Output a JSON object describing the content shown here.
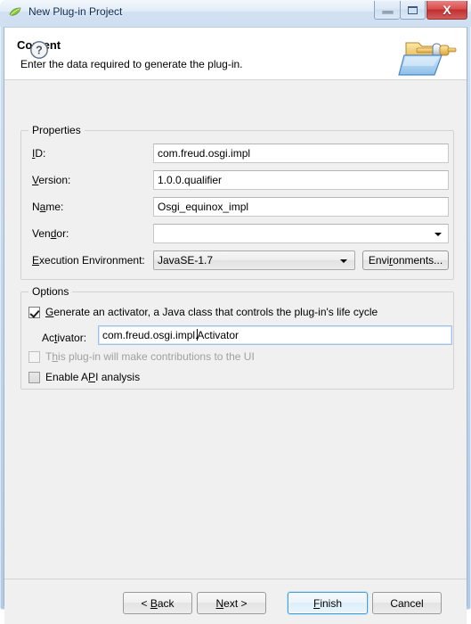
{
  "window": {
    "title": "New Plug-in Project",
    "icon": "eclipse-leaf-icon",
    "buttons": {
      "minimize": "minimize-icon",
      "maximize": "maximize-icon",
      "close": "X"
    }
  },
  "header": {
    "title": "Content",
    "description": "Enter the data required to generate the plug-in.",
    "icon": "plugin-wizard-icon"
  },
  "properties": {
    "group_label": "Properties",
    "fields": [
      {
        "label_pre": "",
        "label_mn": "I",
        "label_post": "D:",
        "value": "com.freud.osgi.impl",
        "type": "text"
      },
      {
        "label_pre": "",
        "label_mn": "V",
        "label_post": "ersion:",
        "value": "1.0.0.qualifier",
        "type": "text"
      },
      {
        "label_pre": "N",
        "label_mn": "a",
        "label_post": "me:",
        "value": "Osgi_equinox_impl",
        "type": "text"
      },
      {
        "label_pre": "Ven",
        "label_mn": "d",
        "label_post": "or:",
        "value": "",
        "type": "combo-edit"
      }
    ],
    "execution_environment": {
      "label_pre": "",
      "label_mn": "E",
      "label_post": "xecution Environment:",
      "value": "JavaSE-1.7",
      "button": {
        "pre": "Envi",
        "mn": "r",
        "post": "onments..."
      }
    }
  },
  "options": {
    "group_label": "Options",
    "generate_activator": {
      "label_pre": "",
      "label_mn": "G",
      "label_post": "enerate an activator, a Java class that controls the plug-in's life cycle",
      "checked": true
    },
    "activator": {
      "label_pre": "Ac",
      "label_mn": "t",
      "label_post": "ivator:",
      "value_before_caret": "com.freud.osgi.impl.",
      "value_after_caret": "Activator"
    },
    "ui_contributions": {
      "label_pre": "T",
      "label_mn": "h",
      "label_post": "is plug-in will make contributions to the UI",
      "checked": false,
      "disabled": true
    },
    "api_analysis": {
      "label_pre": "Enable A",
      "label_mn": "P",
      "label_post": "I analysis",
      "checked": false,
      "disabled": false
    }
  },
  "buttonbar": {
    "help": "help-icon",
    "back": {
      "pre": "< ",
      "mn": "B",
      "post": "ack"
    },
    "next": {
      "pre": "",
      "mn": "N",
      "post": "ext >"
    },
    "finish": {
      "pre": "",
      "mn": "F",
      "post": "inish"
    },
    "cancel": {
      "pre": "Cancel",
      "mn": "",
      "post": ""
    }
  }
}
